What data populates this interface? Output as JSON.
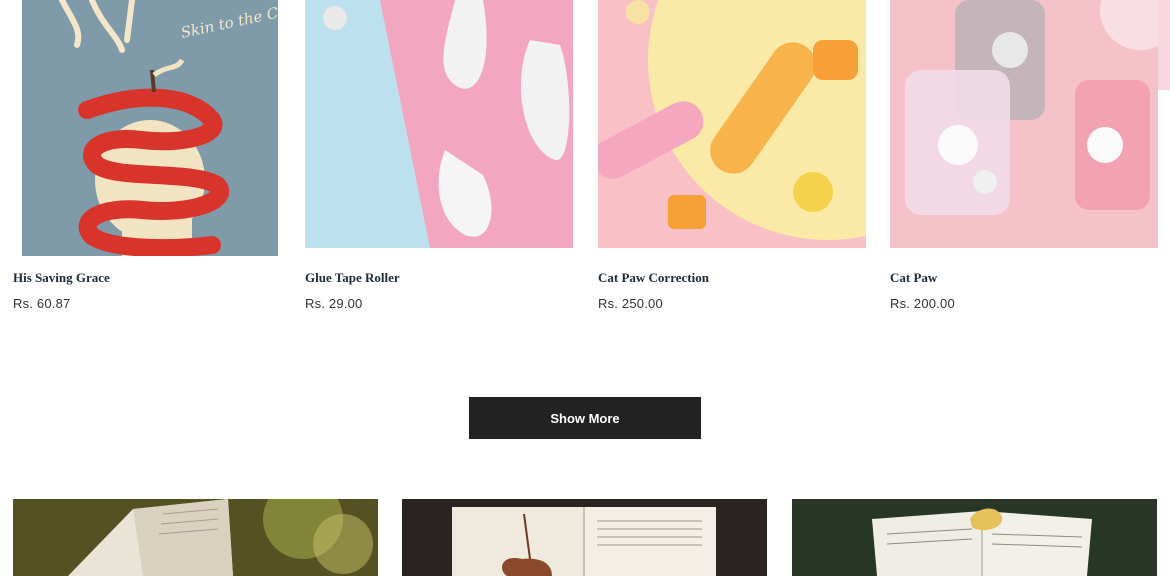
{
  "products": [
    {
      "name": "His Saving Grace",
      "price": "Rs. 60.87",
      "image": "book-cover-apple-peel",
      "cover_script": "Skin to the Core"
    },
    {
      "name": "Glue Tape Roller",
      "price": "Rs. 29.00",
      "image": "glue-tape-rollers"
    },
    {
      "name": "Cat Paw Correction",
      "price": "Rs. 250.00",
      "image": "cat-paw-correction-pens"
    },
    {
      "name": "Cat Paw",
      "price": "Rs. 200.00",
      "image": "cat-paw-tape"
    }
  ],
  "show_more_label": "Show More",
  "banners": [
    {
      "image": "open-book-on-grass"
    },
    {
      "image": "open-book-with-leaf"
    },
    {
      "image": "open-book-with-yellow-leaf"
    }
  ],
  "colors": {
    "button_bg": "#222222",
    "product_name": "#1d2b3a",
    "price": "#333333",
    "book_cover_bg": "#7f9aa8",
    "peel_red": "#d8342b"
  }
}
